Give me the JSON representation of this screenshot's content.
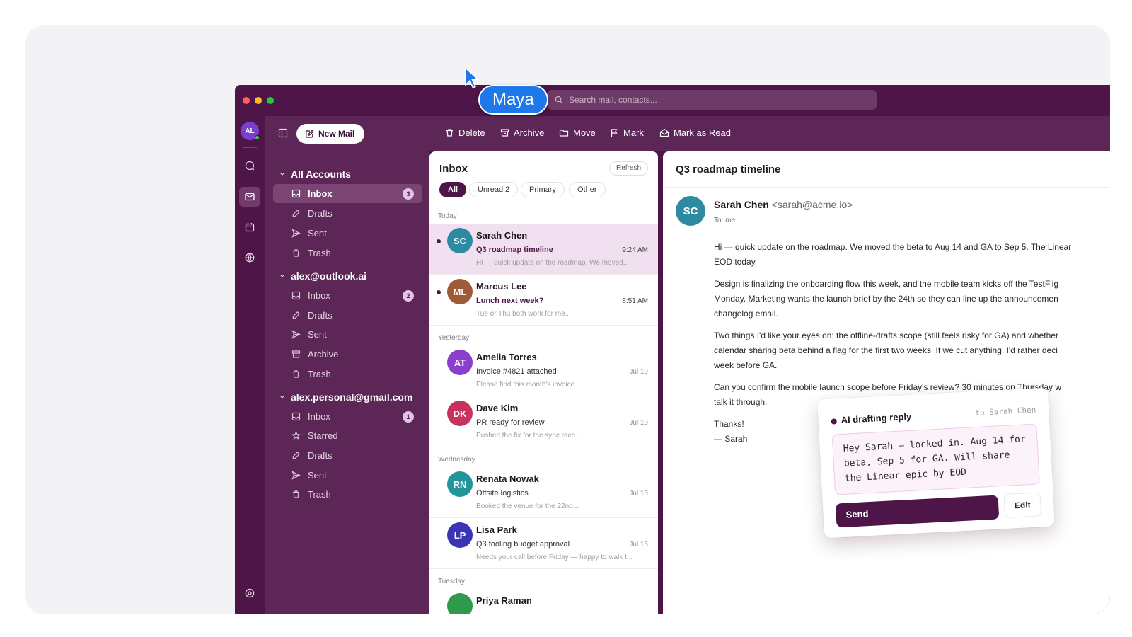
{
  "presence": {
    "name": "Maya",
    "color": "#1f78ea"
  },
  "search": {
    "placeholder": "Search mail, contacts..."
  },
  "rail": {
    "avatar_initials": "AL",
    "icons": [
      "chat-icon",
      "mail-icon",
      "calendar-icon",
      "globe-icon",
      "settings-icon"
    ]
  },
  "toolbar": {
    "new_mail": "New Mail",
    "actions": [
      "Delete",
      "Archive",
      "Move",
      "Mark",
      "Mark as Read"
    ]
  },
  "folders": {
    "accounts": [
      {
        "name": "All Accounts",
        "items": [
          {
            "label": "Inbox",
            "badge": "3",
            "icon": "inbox-icon"
          },
          {
            "label": "Drafts",
            "icon": "drafts-icon"
          },
          {
            "label": "Sent",
            "icon": "send-icon"
          },
          {
            "label": "Trash",
            "icon": "trash-icon"
          }
        ]
      },
      {
        "name": "alex@outlook.ai",
        "items": [
          {
            "label": "Inbox",
            "badge": "2",
            "icon": "inbox-icon"
          },
          {
            "label": "Drafts",
            "icon": "drafts-icon"
          },
          {
            "label": "Sent",
            "icon": "send-icon"
          },
          {
            "label": "Archive",
            "icon": "archive-icon"
          },
          {
            "label": "Trash",
            "icon": "trash-icon"
          }
        ]
      },
      {
        "name": "alex.personal@gmail.com",
        "items": [
          {
            "label": "Inbox",
            "badge": "1",
            "icon": "inbox-icon"
          },
          {
            "label": "Starred",
            "icon": "star-icon"
          },
          {
            "label": "Drafts",
            "icon": "drafts-icon"
          },
          {
            "label": "Sent",
            "icon": "send-icon"
          },
          {
            "label": "Trash",
            "icon": "trash-icon"
          }
        ]
      }
    ]
  },
  "list": {
    "title": "Inbox",
    "refresh": "Refresh",
    "filters": [
      "All",
      "Unread 2",
      "Primary",
      "Other"
    ],
    "groups": [
      "Today",
      "Yesterday",
      "Wednesday",
      "Tuesday"
    ],
    "messages": [
      {
        "initials": "SC",
        "color": "#2d8aa0",
        "sender": "Sarah Chen",
        "subject": "Q3 roadmap timeline",
        "time": "9:24 AM",
        "preview": "Hi — quick update on the roadmap. We moved..."
      },
      {
        "initials": "ML",
        "color": "#a15a38",
        "sender": "Marcus Lee",
        "subject": "Lunch next week?",
        "time": "8:51 AM",
        "preview": "Tue or Thu both work for me..."
      },
      {
        "initials": "AT",
        "color": "#8a3fcf",
        "sender": "Amelia Torres",
        "subject": "Invoice #4821 attached",
        "time": "Jul 19",
        "preview": "Please find this month's invoice..."
      },
      {
        "initials": "DK",
        "color": "#c8325f",
        "sender": "Dave Kim",
        "subject": "PR ready for review",
        "time": "Jul 19",
        "preview": "Pushed the fix for the sync race..."
      },
      {
        "initials": "RN",
        "color": "#21969a",
        "sender": "Renata Nowak",
        "subject": "Offsite logistics",
        "time": "Jul 15",
        "preview": "Booked the venue for the 22nd..."
      },
      {
        "initials": "LP",
        "color": "#3a35b5",
        "sender": "Lisa Park",
        "subject": "Q3 tooling budget approval",
        "time": "Jul 15",
        "preview": "Needs your call before Friday — happy to walk t..."
      },
      {
        "initials": "",
        "color": "#2f9a4a",
        "sender": "Priya Raman",
        "subject": "",
        "time": "",
        "preview": ""
      }
    ]
  },
  "reading": {
    "subject": "Q3 roadmap timeline",
    "avatar_initials": "SC",
    "from_name": "Sarah Chen",
    "from_email": "<sarah@acme.io>",
    "to": "To: me",
    "body": [
      "Hi — quick update on the roadmap. We moved the beta to Aug 14 and GA to Sep 5. The Linear",
      "EOD today.",
      "Design is finalizing the onboarding flow this week, and the mobile team kicks off the TestFlig",
      "Monday. Marketing wants the launch brief by the 24th so they can line up the announcemen",
      "changelog email.",
      "Two things I'd like your eyes on: the offline-drafts scope (still feels risky for GA) and whether",
      "calendar sharing beta behind a flag for the first two weeks. If we cut anything, I'd rather deci",
      "week before GA.",
      "Can you confirm the mobile launch scope before Friday's review? 30 minutes on Thursday w",
      "talk it through.",
      "Thanks!",
      "— Sarah"
    ]
  },
  "ai": {
    "title": "AI drafting reply",
    "to": "to Sarah Chen",
    "draft": "Hey Sarah — locked in. Aug 14 for beta, Sep 5 for GA. Will share the Linear epic by EOD",
    "send": "Send",
    "edit": "Edit"
  }
}
